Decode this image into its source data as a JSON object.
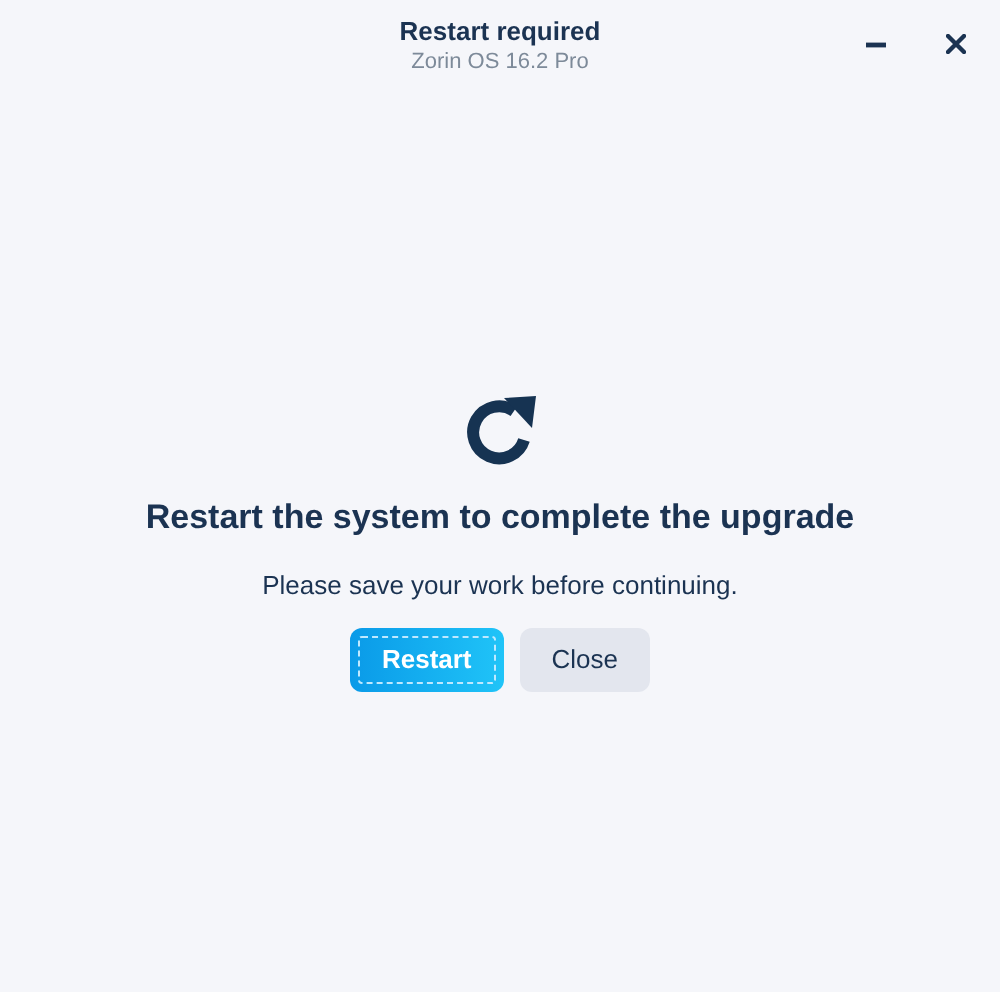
{
  "window": {
    "title": "Restart required",
    "subtitle": "Zorin OS 16.2 Pro"
  },
  "message": {
    "heading": "Restart the system to complete the upgrade",
    "body": "Please save your work before continuing."
  },
  "buttons": [
    {
      "label": "Restart",
      "kind": "primary",
      "focused": true
    },
    {
      "label": "Close",
      "kind": "secondary",
      "focused": false
    }
  ]
}
